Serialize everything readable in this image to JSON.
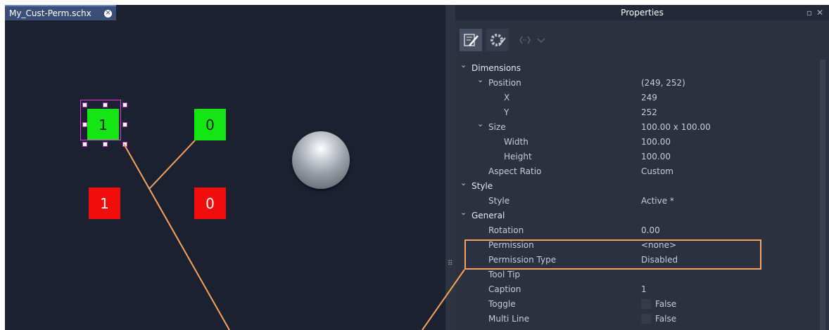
{
  "canvas": {
    "tab_label": "My_Cust-Perm.schx",
    "buttons": [
      {
        "label": "1",
        "color": "#14e614"
      },
      {
        "label": "0",
        "color": "#14e614"
      },
      {
        "label": "1",
        "color": "#f20d0d"
      },
      {
        "label": "0",
        "color": "#f20d0d"
      }
    ],
    "background": "#1b2130"
  },
  "props": {
    "title": "Properties",
    "toolbar_icons": [
      "edit-icon",
      "gear-icon",
      "code-icon",
      "chevron-down-icon"
    ],
    "rows": [
      {
        "name": "Dimensions",
        "value": "",
        "level": 0,
        "expandable": true
      },
      {
        "name": "Position",
        "value": "(249, 252)",
        "level": 1,
        "expandable": true
      },
      {
        "name": "X",
        "value": "249",
        "level": 2
      },
      {
        "name": "Y",
        "value": "252",
        "level": 2
      },
      {
        "name": "Size",
        "value": "100.00 x 100.00",
        "level": 1,
        "expandable": true
      },
      {
        "name": "Width",
        "value": "100.00",
        "level": 2
      },
      {
        "name": "Height",
        "value": "100.00",
        "level": 2
      },
      {
        "name": "Aspect Ratio",
        "value": "Custom",
        "level": 1
      },
      {
        "name": "Style",
        "value": "",
        "level": 0,
        "expandable": true
      },
      {
        "name": "Style",
        "value": "Active *",
        "level": 1
      },
      {
        "name": "General",
        "value": "",
        "level": 0,
        "expandable": true
      },
      {
        "name": "Rotation",
        "value": "0.00",
        "level": 1
      },
      {
        "name": "Permission",
        "value": "<none>",
        "level": 1
      },
      {
        "name": "Permission Type",
        "value": "Disabled",
        "level": 1
      },
      {
        "name": "Tool Tip",
        "value": "",
        "level": 1
      },
      {
        "name": "Caption",
        "value": "1",
        "level": 1
      },
      {
        "name": "Toggle",
        "value": "False",
        "level": 1,
        "checkbox": true
      },
      {
        "name": "Multi Line",
        "value": "False",
        "level": 1,
        "checkbox": true
      }
    ]
  },
  "colors": {
    "annotation": "#f6a35e",
    "selection": "#e13ad7"
  }
}
